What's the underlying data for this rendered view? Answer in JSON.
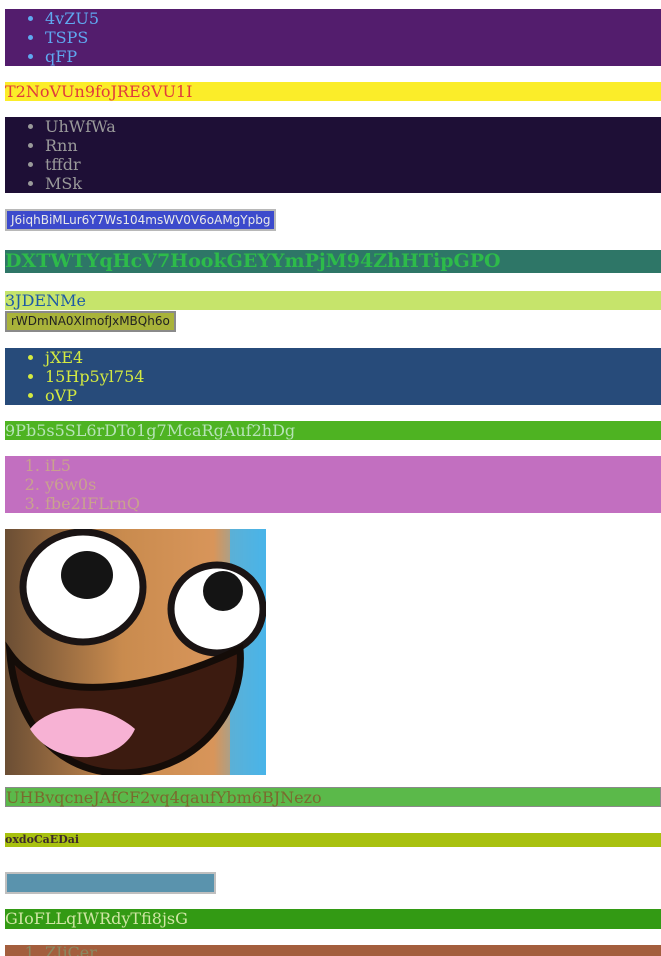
{
  "list1": {
    "items": [
      "4vZU5",
      "TSPS",
      "qFP"
    ]
  },
  "banner1": "T2NoVUn9foJRE8VU1I",
  "list2": {
    "items": [
      "UhWfWa",
      "Rnn",
      "tffdr",
      "MSk"
    ]
  },
  "button1": "J6iqhBiMLur6Y7Ws104msWV0V6oAMgYpbg",
  "heading1": "DXTWTYqHcV7HookGEYYmPjM94ZhHTipGPO",
  "banner2": "3JDENMe",
  "button2": "rWDmNA0XImofJxMBQh6o",
  "list3": {
    "items": [
      "jXE4",
      "15Hp5yl754",
      "oVP"
    ]
  },
  "banner3": "9Pb5s5SL6rDTo1g7McaRgAuf2hDg",
  "list4": {
    "items": [
      "iL5",
      "y6w0s",
      "fbe2IFLrnQ"
    ]
  },
  "image": {
    "icon": "smiley-face-image"
  },
  "banner4": "UHBvqcneJAfCF2vq4qaufYbm6BJNezo",
  "label1": "oxdoCaEDai",
  "banner5": "GIoFLLqIWRdyTfi8jsG",
  "list5": {
    "items": [
      "ZIiCer"
    ]
  }
}
